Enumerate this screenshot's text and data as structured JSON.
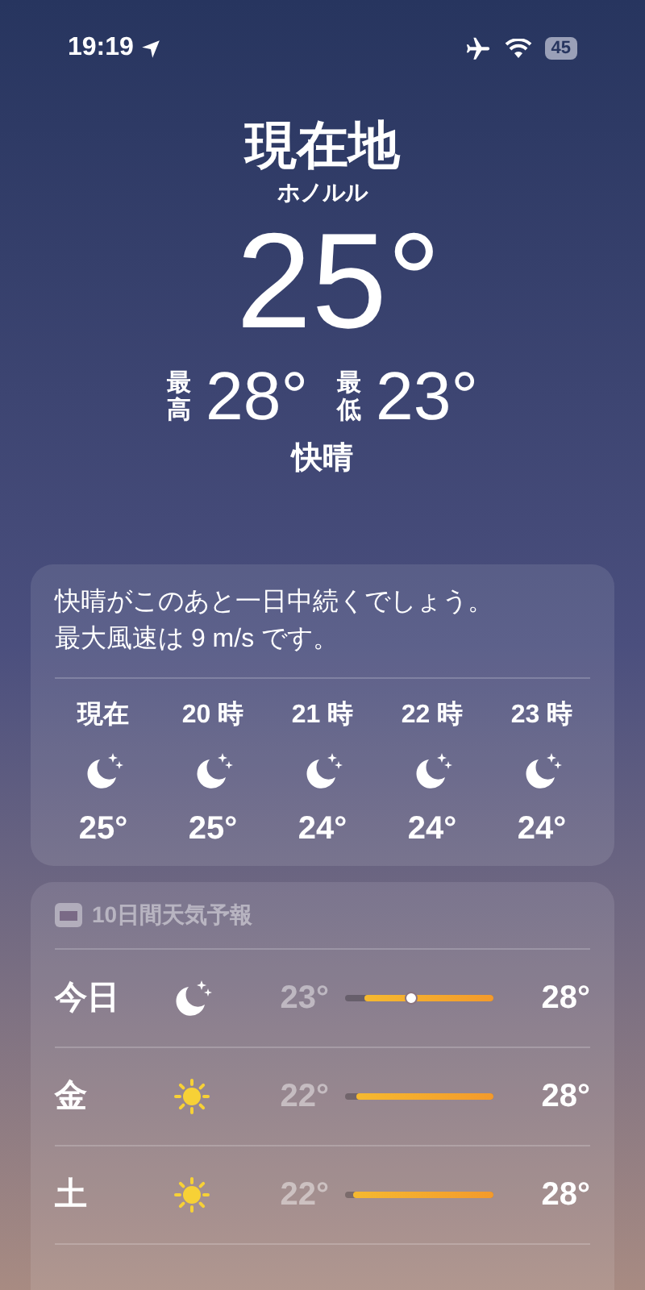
{
  "status_bar": {
    "time": "19:19",
    "battery": "45"
  },
  "location": {
    "title": "現在地",
    "city": "ホノルル",
    "temperature": "25°",
    "high_label": "最高",
    "high": "28°",
    "low_label": "最低",
    "low": "23°",
    "condition": "快晴"
  },
  "hourly": {
    "summary": [
      "快晴がこのあと一日中続くでしょう。",
      "最大風速は 9 m/s です。"
    ],
    "hours": [
      {
        "time": "現在",
        "kind": "moon",
        "temp": "25°"
      },
      {
        "time": "20 時",
        "kind": "moon",
        "temp": "25°"
      },
      {
        "time": "21 時",
        "kind": "moon",
        "temp": "24°"
      },
      {
        "time": "22 時",
        "kind": "moon",
        "temp": "24°"
      },
      {
        "time": "23 時",
        "kind": "moon",
        "temp": "24°"
      }
    ]
  },
  "daily": {
    "title": "10日間天気予報",
    "days": [
      {
        "day": "今日",
        "kind": "moon",
        "low": "23°",
        "high": "28°",
        "level": 0.87,
        "now_marker": {
          "level": 0.45
        }
      },
      {
        "day": "金",
        "kind": "sun",
        "low": "22°",
        "high": "28°",
        "level": 0.92
      },
      {
        "day": "土",
        "kind": "sun",
        "low": "22°",
        "high": "28°",
        "level": 0.95
      }
    ]
  }
}
